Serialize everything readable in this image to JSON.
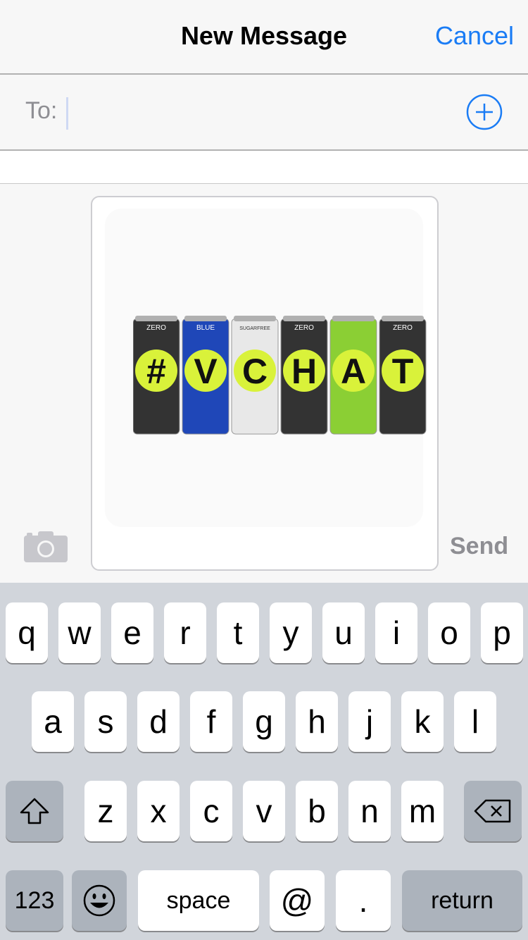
{
  "header": {
    "title": "New Message",
    "cancel_label": "Cancel"
  },
  "recipient": {
    "label": "To:"
  },
  "composer": {
    "attachment_alt": "#VCHAT",
    "can_labels": [
      "ZERO",
      "BLUE",
      "SUGARFREE",
      "ZERO",
      "",
      "ZERO"
    ],
    "can_colors": [
      "#333333",
      "#1f47b8",
      "#e8e8e8",
      "#333333",
      "#8bcf34",
      "#333333"
    ],
    "send_label": "Send"
  },
  "keyboard": {
    "row1": [
      "q",
      "w",
      "e",
      "r",
      "t",
      "y",
      "u",
      "i",
      "o",
      "p"
    ],
    "row2": [
      "a",
      "s",
      "d",
      "f",
      "g",
      "h",
      "j",
      "k",
      "l"
    ],
    "row3": [
      "z",
      "x",
      "c",
      "v",
      "b",
      "n",
      "m"
    ],
    "numbers_label": "123",
    "space_label": "space",
    "at_label": "@",
    "dot_label": ".",
    "return_label": "return"
  },
  "icons": [
    "plus-circle-icon",
    "camera-icon",
    "shift-icon",
    "backspace-icon",
    "emoji-icon"
  ],
  "colors": {
    "accent": "#1a7cf5",
    "keyboard_bg": "#d1d5db",
    "dark_key": "#acb3bc"
  }
}
